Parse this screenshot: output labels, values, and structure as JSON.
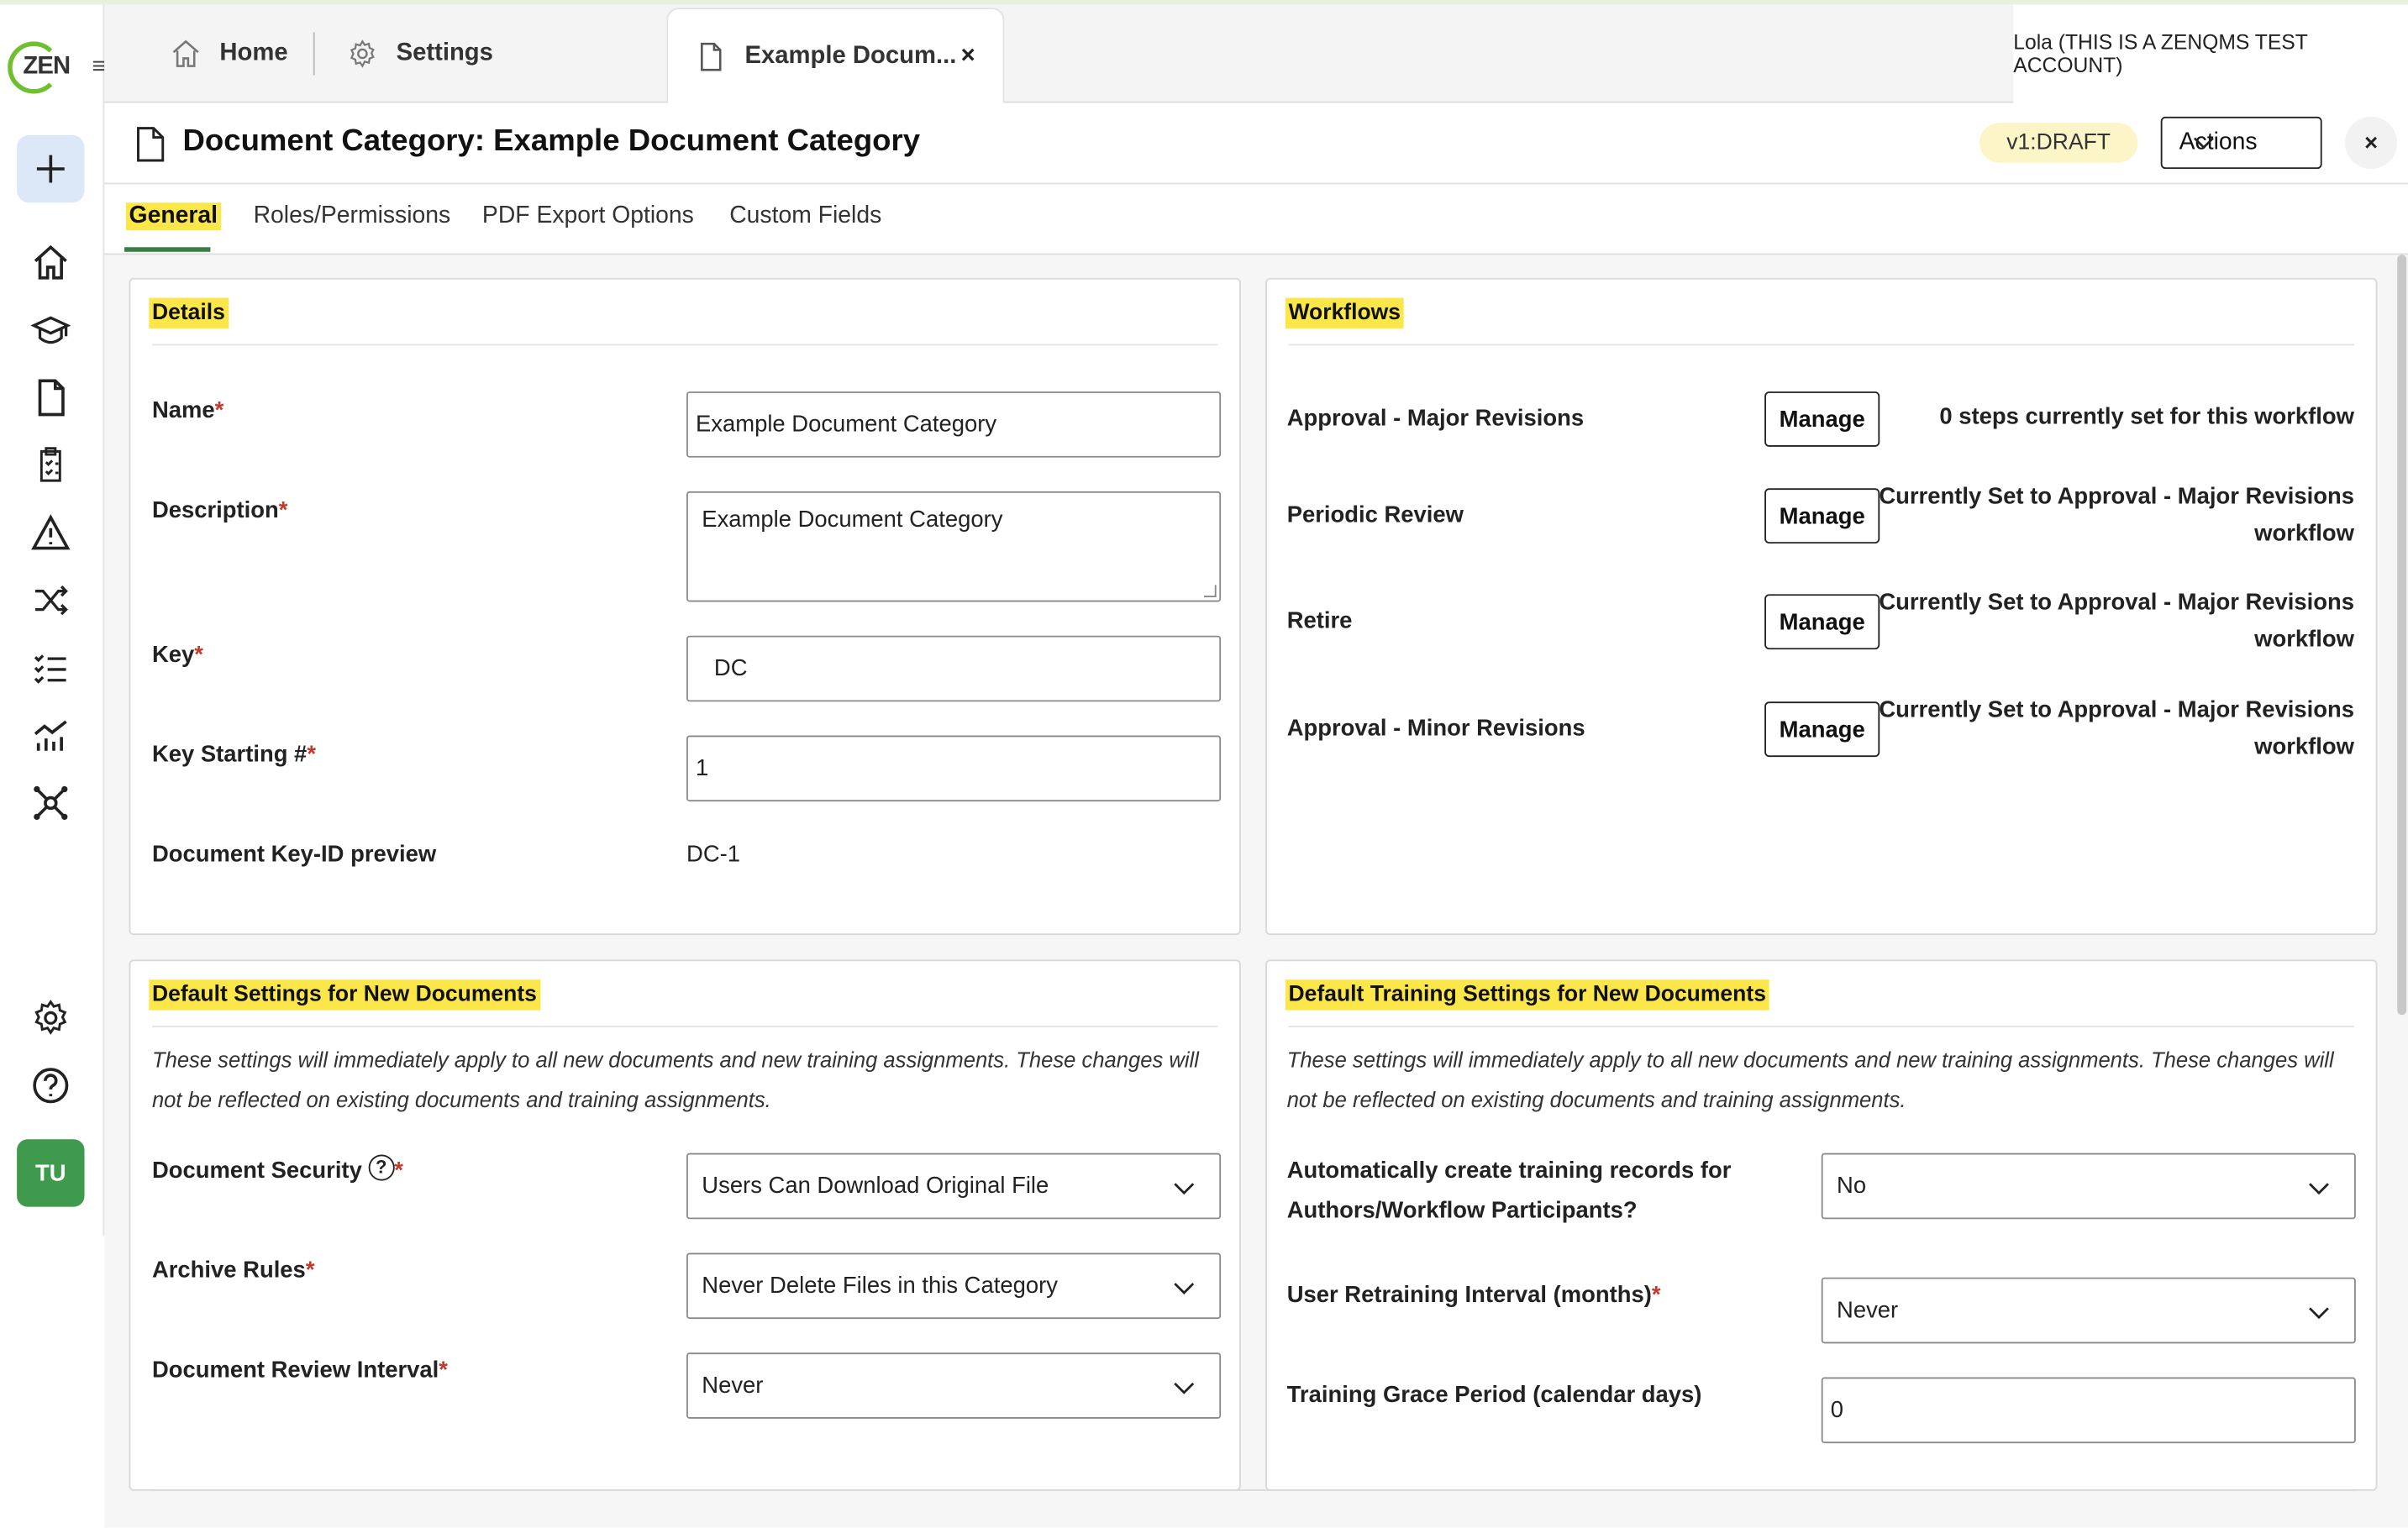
{
  "app": {
    "logo_text": "ZEN",
    "account": "Lola (THIS IS A ZENQMS TEST ACCOUNT)",
    "avatar_initials": "TU",
    "accent": "#3a7d44",
    "highlight": "#fbe74a"
  },
  "tabs": [
    {
      "label": "Home",
      "icon": "home-icon"
    },
    {
      "label": "Settings",
      "icon": "gear-icon"
    },
    {
      "label": "Example Docum...",
      "icon": "document-icon",
      "close": "×",
      "active": true
    }
  ],
  "header": {
    "title": "Document Category: Example Document Category",
    "version_badge": "v1:DRAFT",
    "actions_label": "Actions",
    "close_label": "×"
  },
  "subtabs": [
    "General",
    "Roles/Permissions",
    "PDF Export Options",
    "Custom Fields"
  ],
  "details": {
    "heading": "Details",
    "name_label": "Name",
    "name_value": "Example Document Category",
    "description_label": "Description",
    "description_value": "Example Document Category",
    "key_label": "Key",
    "key_value": "DC",
    "key_start_label": "Key Starting #",
    "key_start_value": "1",
    "preview_label": "Document Key-ID preview",
    "preview_value": "DC-1",
    "required_mark": "*"
  },
  "workflows": {
    "heading": "Workflows",
    "manage_label": "Manage",
    "items": [
      {
        "name": "Approval - Major Revisions",
        "status": "0 steps currently set for this workflow"
      },
      {
        "name": "Periodic Review",
        "status": "Currently Set to Approval - Major Revisions workflow"
      },
      {
        "name": "Retire",
        "status": "Currently Set to Approval - Major Revisions workflow"
      },
      {
        "name": "Approval - Minor Revisions",
        "status": "Currently Set to Approval - Major Revisions workflow"
      }
    ]
  },
  "defaults": {
    "heading": "Default Settings for New Documents",
    "note": "These settings will immediately apply to all new documents and new training assignments. These changes will not be reflected on existing documents and training assignments.",
    "security_label": "Document Security",
    "help_glyph": "?",
    "security_value": "Users Can Download Original File",
    "archive_label": "Archive Rules",
    "archive_value": "Never Delete Files in this Category",
    "review_label": "Document Review Interval",
    "review_value": "Never"
  },
  "training": {
    "heading": "Default Training Settings for New Documents",
    "note": "These settings will immediately apply to all new documents and new training assignments. These changes will not be reflected on existing documents and training assignments.",
    "auto_label_1": "Automatically create training records for",
    "auto_label_2": "Authors/Workflow Participants?",
    "auto_value": "No",
    "retrain_label": "User Retraining Interval (months)",
    "retrain_value": "Never",
    "grace_label": "Training Grace Period (calendar days)",
    "grace_value": "0"
  }
}
